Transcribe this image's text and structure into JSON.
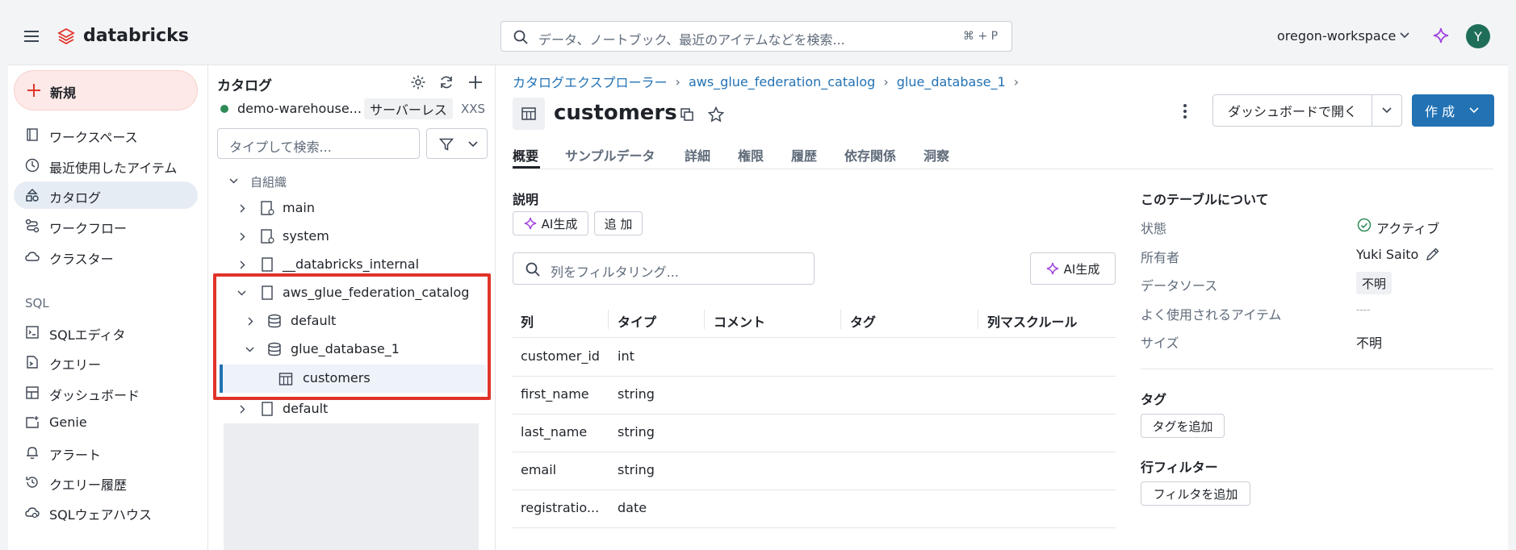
{
  "header": {
    "brand": "databricks",
    "search_placeholder": "データ、ノートブック、最近のアイテムなどを検索...",
    "search_shortcut": "⌘ + P",
    "workspace": "oregon-workspace",
    "avatar_letter": "Y"
  },
  "sidebar": {
    "new_label": "新規",
    "items": [
      {
        "label": "ワークスペース",
        "icon": "workspace-icon"
      },
      {
        "label": "最近使用したアイテム",
        "icon": "clock-icon"
      },
      {
        "label": "カタログ",
        "icon": "catalog-icon"
      },
      {
        "label": "ワークフロー",
        "icon": "workflow-icon"
      },
      {
        "label": "クラスター",
        "icon": "cloud-icon"
      }
    ],
    "sql_section": "SQL",
    "sql_items": [
      {
        "label": "SQLエディタ",
        "icon": "sql-editor-icon"
      },
      {
        "label": "クエリー",
        "icon": "query-icon"
      },
      {
        "label": "ダッシュボード",
        "icon": "dashboard-icon"
      },
      {
        "label": "Genie",
        "icon": "genie-icon"
      },
      {
        "label": "アラート",
        "icon": "bell-icon"
      },
      {
        "label": "クエリー履歴",
        "icon": "history-icon"
      },
      {
        "label": "SQLウェアハウス",
        "icon": "warehouse-icon"
      }
    ]
  },
  "catalog_panel": {
    "title": "カタログ",
    "warehouse_name": "demo-warehouse...",
    "warehouse_type": "サーバーレス",
    "warehouse_size": "XXS",
    "search_placeholder": "タイプして検索...",
    "org_label": "自組織",
    "tree": [
      {
        "label": "main"
      },
      {
        "label": "system"
      },
      {
        "label": "__databricks_internal"
      },
      {
        "label": "aws_glue_federation_catalog"
      },
      {
        "label": "default"
      },
      {
        "label": "glue_database_1"
      },
      {
        "label": "customers"
      },
      {
        "label": "default"
      }
    ]
  },
  "breadcrumb": {
    "items": [
      "カタログエクスプローラー",
      "aws_glue_federation_catalog",
      "glue_database_1"
    ],
    "separator": "›"
  },
  "table_header": {
    "title": "customers",
    "open_dashboard": "ダッシュボードで開く",
    "create": "作 成"
  },
  "tabs": [
    "概要",
    "サンプルデータ",
    "詳細",
    "権限",
    "履歴",
    "依存関係",
    "洞察"
  ],
  "description": {
    "label": "説明",
    "ai_generate": "AI生成",
    "add": "追 加",
    "filter_placeholder": "列をフィルタリング...",
    "ai_generate_2": "AI生成"
  },
  "columns_table": {
    "headers": [
      "列",
      "タイプ",
      "コメント",
      "タグ",
      "列マスクルール"
    ],
    "rows": [
      {
        "name": "customer_id",
        "type": "int"
      },
      {
        "name": "first_name",
        "type": "string"
      },
      {
        "name": "last_name",
        "type": "string"
      },
      {
        "name": "email",
        "type": "string"
      },
      {
        "name": "registratio...",
        "type": "date"
      }
    ]
  },
  "about": {
    "title": "このテーブルについて",
    "status_label": "状態",
    "status_value": "アクティブ",
    "owner_label": "所有者",
    "owner_value": "Yuki Saito",
    "source_label": "データソース",
    "source_value": "不明",
    "frequent_label": "よく使用されるアイテム",
    "frequent_value": "----",
    "size_label": "サイズ",
    "size_value": "不明",
    "tags_label": "タグ",
    "add_tag": "タグを追加",
    "row_filter_label": "行フィルター",
    "add_filter": "フィルタを追加"
  },
  "colors": {
    "accent": "#2272b4",
    "highlight_border": "#e0332a",
    "active_nav_bg": "#e6ecf3",
    "status_green": "#2e8b57",
    "avatar_bg": "#1f6e5a",
    "new_btn_bg": "#fde9e7"
  }
}
